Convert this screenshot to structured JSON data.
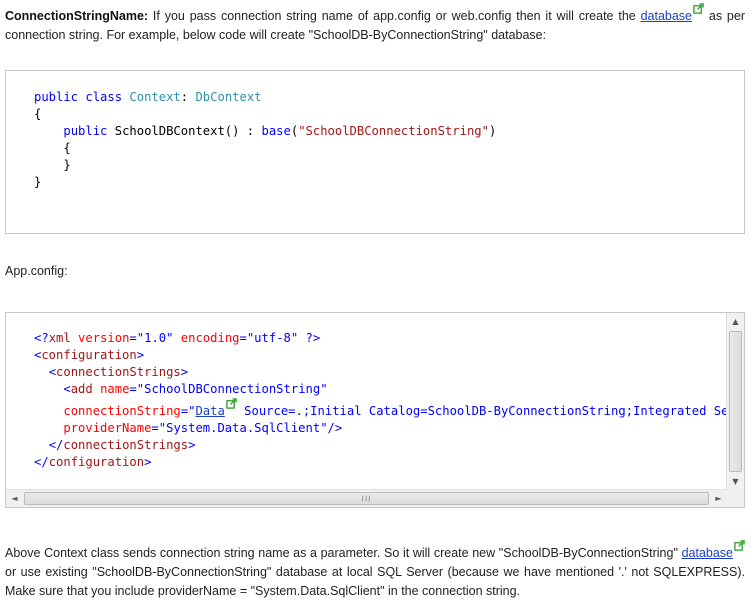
{
  "intro": {
    "term": "ConnectionStringName:",
    "text1": " If you pass connection string name of app.config or web.config then it will create the ",
    "link": "database",
    "text2": " as per connection string. For example, below code will create \"SchoolDB-ByConnectionString\" database:"
  },
  "code1": {
    "l1_kw1": "public",
    "l1_kw2": "class",
    "l1_type1": "Context",
    "l1_colon": ":",
    "l1_type2": "DbContext",
    "l2": "{",
    "l3_kw": "public",
    "l3_name": "SchoolDBContext() : ",
    "l3_base": "base",
    "l3_open": "(",
    "l3_str": "\"SchoolDBConnectionString\"",
    "l3_close": ")",
    "l4": "{",
    "l5": "}",
    "l6": "}"
  },
  "label_appconfig": "App.config:",
  "code2": {
    "l1_open": "<?",
    "l1_tag": "xml",
    "l1_attr1": "version",
    "l1_eq1": "=",
    "l1_val1": "\"1.0\"",
    "l1_attr2": "encoding",
    "l1_eq2": "=",
    "l1_val2": "\"utf-8\"",
    "l1_close": " ?>",
    "l2_lt": "<",
    "l2_tag": "configuration",
    "l2_gt": ">",
    "l3_lt": "<",
    "l3_tag": "connectionStrings",
    "l3_gt": ">",
    "l4_lt": "<",
    "l4_tag": "add",
    "l4_attr": "name",
    "l4_eq": "=",
    "l4_val": "\"SchoolDBConnectionString\"",
    "l5_attr": "connectionString",
    "l5_eq": "=",
    "l5_q": "\"",
    "l5_link": "Data",
    "l5_rest": " Source=.;Initial Catalog=SchoolDB-ByConnectionString;Integrated Security=true\"",
    "l6_attr": "providerName",
    "l6_eq": "=",
    "l6_val": "\"System.Data.SqlClient\"",
    "l6_close": "/>",
    "l7_lt": "</",
    "l7_tag": "connectionStrings",
    "l7_gt": ">",
    "l8_lt": "</",
    "l8_tag": "configuration",
    "l8_gt": ">"
  },
  "scroll": {
    "up": "▲",
    "down": "▼",
    "left": "◄",
    "right": "►",
    "grip": "III"
  },
  "outro": {
    "text1": "Above Context class sends connection string name as a parameter. So it will create new \"SchoolDB-ByConnectionString\" ",
    "link": "database",
    "text2": " or use existing \"SchoolDB-ByConnectionString\" database at local SQL Server (because we have mentioned '.' not SQLEXPRESS). Make sure that you include providerName = \"System.Data.SqlClient\" in the connection string."
  },
  "colors": {
    "link": "#1a3fbf",
    "keyword": "#0000ff",
    "type": "#2b91af",
    "string": "#a31515",
    "xml_attr": "#ff0000",
    "ext_icon": "#3aa335"
  }
}
